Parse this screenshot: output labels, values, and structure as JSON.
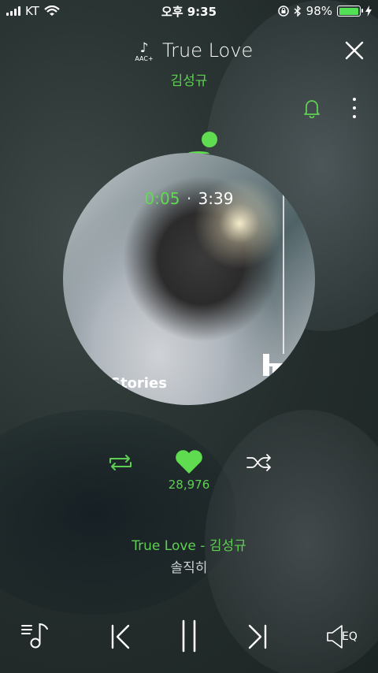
{
  "status_bar": {
    "carrier": "KT",
    "time": "오후 9:35",
    "battery_percent": "98%",
    "battery_level": 0.98,
    "icons": [
      "signal-icon",
      "wifi-icon",
      "rotation-lock-icon",
      "bluetooth-icon",
      "battery-icon",
      "charging-icon"
    ]
  },
  "header": {
    "quality_badge": "AAC+",
    "song_title": "True Love",
    "artist": "김성규",
    "icons": [
      "music-note-icon",
      "close-icon",
      "bell-icon",
      "more-icon"
    ]
  },
  "album": {
    "cover_text": "Stories",
    "progress": {
      "current": "0:05",
      "separator": "·",
      "total": "3:39",
      "fraction": 0.023
    }
  },
  "actions": {
    "likes": "28,976",
    "icons": [
      "repeat-icon",
      "heart-icon",
      "shuffle-icon"
    ]
  },
  "lyrics": {
    "line1": "True Love - 김성규",
    "line2": "솔직히"
  },
  "controls": {
    "eq_label": "EQ",
    "icons": [
      "playlist-icon",
      "previous-icon",
      "pause-icon",
      "next-icon",
      "equalizer-icon"
    ]
  },
  "colors": {
    "accent": "#5fdc4f",
    "text": "#ffffff"
  }
}
